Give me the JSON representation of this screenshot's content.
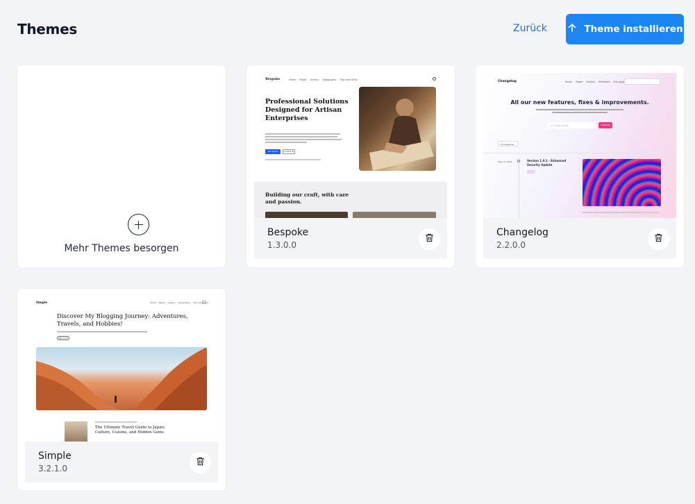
{
  "header": {
    "title": "Themes",
    "back_label": "Zurück",
    "install_label": "Theme installieren"
  },
  "more_card": {
    "label": "Mehr Themes besorgen"
  },
  "themes": [
    {
      "name": "Bespoke",
      "version": "1.3.0.0",
      "preview": {
        "brand": "Bespoke",
        "nav": [
          "Home",
          "Pages",
          "Gallery",
          "Typography",
          "Tips and Tricks"
        ],
        "headline": "Professional Solutions Designed for Artisan Enterprises",
        "cta_primary": "Get started",
        "cta_secondary": "Contact Us",
        "section_title": "Building our craft, with care and passion."
      }
    },
    {
      "name": "Changelog",
      "version": "2.2.0.0",
      "preview": {
        "brand": "Changelog",
        "nav": [
          "Home",
          "Pages",
          "Gallery",
          "Elements",
          "Info page"
        ],
        "headline": "All our new features, fixes & improvements.",
        "input_placeholder": "your email address",
        "subscribe": "Subscribe",
        "filter": "All categories",
        "entry_date": "May 20, 2024",
        "entry_title": "Version 1.0.1 - Enhanced Security Update"
      }
    },
    {
      "name": "Simple",
      "version": "3.2.1.0",
      "preview": {
        "brand": "Simple",
        "nav": [
          "Home",
          "Pages",
          "Gallery",
          "Typography",
          "Tips and Tricks"
        ],
        "headline": "Discover My Blogging Journey: Adventures, Travels, and Hobbies!",
        "cta": "Read more",
        "post_title": "The Ultimate Travel Guide to Japan: Culture, Cuisine, and Hidden Gems"
      }
    }
  ],
  "colors": {
    "accent": "#1c86f2",
    "link": "#1d6fd6",
    "background": "#f3f4f6"
  },
  "icons": {
    "install": "arrow-up-icon",
    "more": "plus-circle-icon",
    "delete": "trash-icon"
  }
}
